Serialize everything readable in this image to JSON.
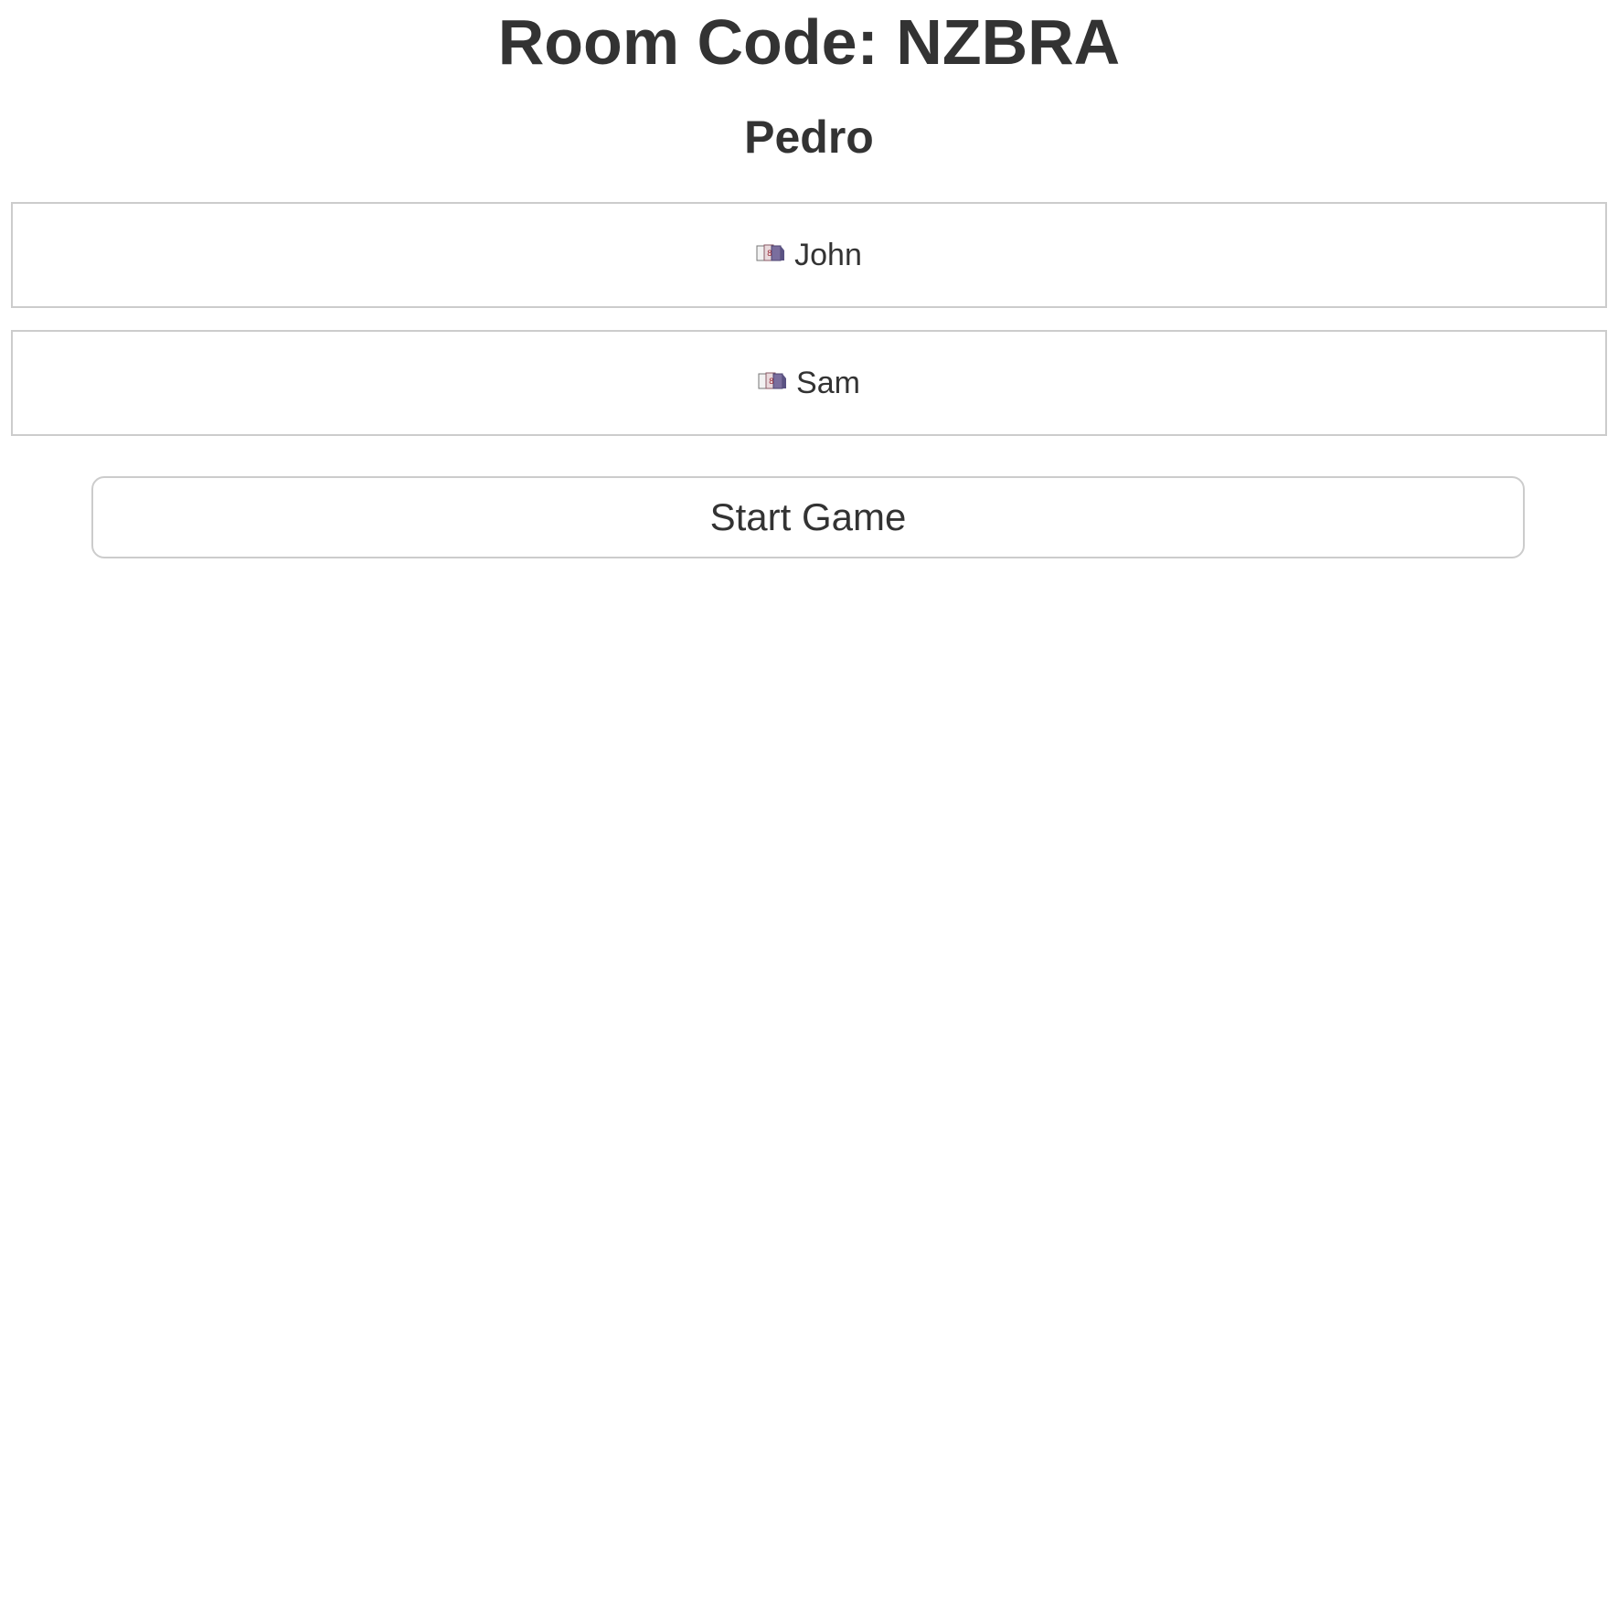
{
  "room": {
    "title": "Room Code: NZBRA"
  },
  "player": {
    "name": "Pedro"
  },
  "players": [
    {
      "name": "John",
      "icon": "card-deck-icon"
    },
    {
      "name": "Sam",
      "icon": "card-deck-icon"
    }
  ],
  "actions": {
    "start_label": "Start Game"
  },
  "colors": {
    "text": "#333333",
    "border": "#cccccc",
    "background": "#ffffff"
  }
}
